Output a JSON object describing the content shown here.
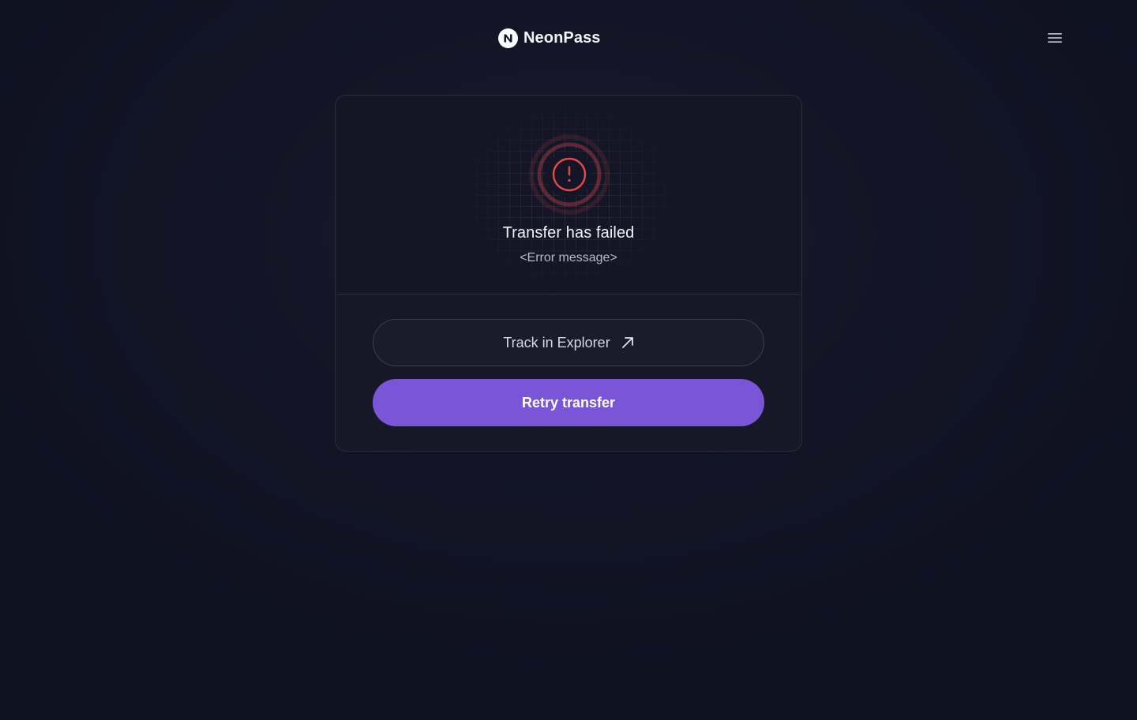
{
  "header": {
    "brand_name": "NeonPass",
    "logo_icon": "neonpass-logo-icon",
    "menu_icon": "hamburger-menu-icon"
  },
  "status": {
    "icon": "alert-circle-icon",
    "title": "Transfer has failed",
    "message": "<Error message>"
  },
  "actions": {
    "explorer_label": "Track in Explorer",
    "explorer_icon": "arrow-up-right-icon",
    "retry_label": "Retry transfer"
  },
  "colors": {
    "accent": "#7b55d8",
    "error": "#e5484d",
    "background": "#0e1120"
  }
}
